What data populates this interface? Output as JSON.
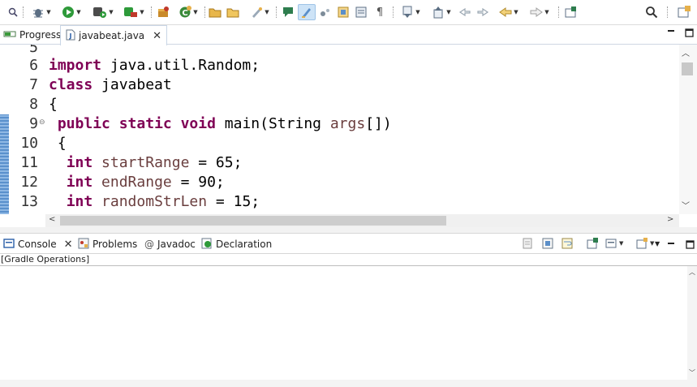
{
  "editor_tabs": [
    {
      "label": "Progress",
      "icon": "progress-icon",
      "active": false
    },
    {
      "label": "javabeat.java",
      "icon": "java-file-icon",
      "active": true,
      "close": "✕"
    }
  ],
  "editor": {
    "lines": [
      {
        "no": "5",
        "text": ""
      },
      {
        "no": "6",
        "text": "import java.util.Random;"
      },
      {
        "no": "7",
        "text": "class javabeat"
      },
      {
        "no": "8",
        "text": "{"
      },
      {
        "no": "9",
        "text": " public static void main(String args[])",
        "fold": "⊖"
      },
      {
        "no": "10",
        "text": " {"
      },
      {
        "no": "11",
        "text": "  int startRange = 65;"
      },
      {
        "no": "12",
        "text": "  int endRange = 90;"
      },
      {
        "no": "13",
        "text": "  int randomStrLen = 15;"
      }
    ]
  },
  "panel_tabs": [
    {
      "label": "Console",
      "icon": "console-icon",
      "close": "✕"
    },
    {
      "label": "Problems",
      "icon": "problems-icon"
    },
    {
      "label": "Javadoc",
      "icon": "javadoc-icon"
    },
    {
      "label": "Declaration",
      "icon": "declaration-icon"
    }
  ],
  "console": {
    "header": "[Gradle Operations]"
  },
  "colors": {
    "keyword": "#7f0055",
    "field": "#6a3e3e",
    "accent": "#6aa0d8"
  }
}
